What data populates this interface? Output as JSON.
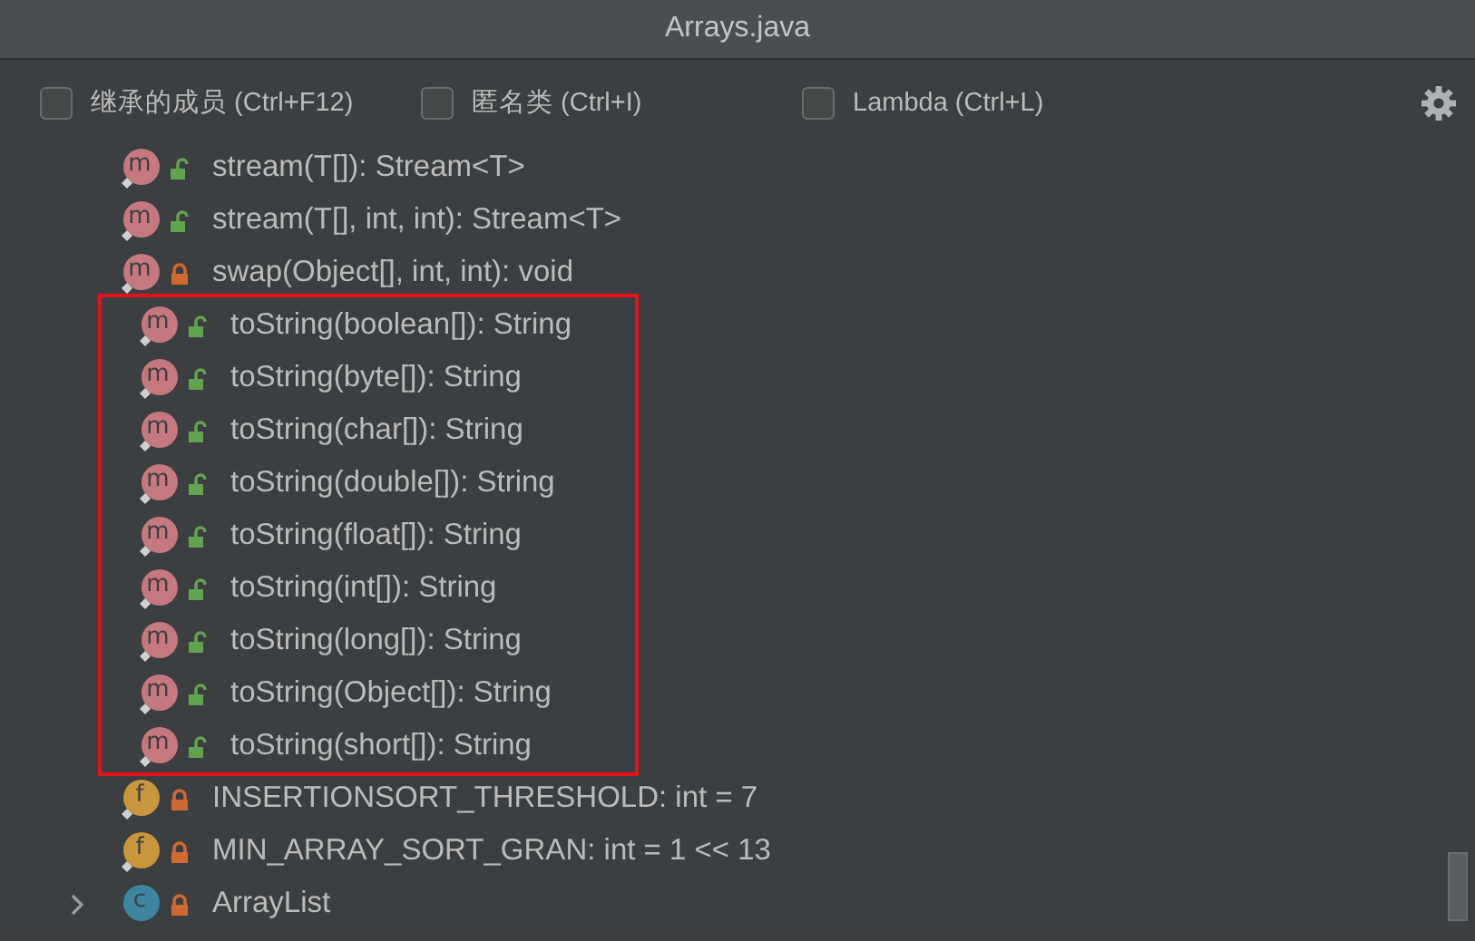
{
  "window": {
    "title": "Arrays.java"
  },
  "filters": [
    {
      "label": "继承的成员 (Ctrl+F12)",
      "checked": false
    },
    {
      "label": "匿名类 (Ctrl+I)",
      "checked": false
    },
    {
      "label": "Lambda (Ctrl+L)",
      "checked": false
    }
  ],
  "members": [
    {
      "kind": "method",
      "icon": "m",
      "locked": false,
      "text": "stream(T[]): Stream<T>",
      "highlighted": false
    },
    {
      "kind": "method",
      "icon": "m",
      "locked": false,
      "text": "stream(T[], int, int): Stream<T>",
      "highlighted": false
    },
    {
      "kind": "method",
      "icon": "m",
      "locked": true,
      "text": "swap(Object[], int, int): void",
      "highlighted": false
    },
    {
      "kind": "method",
      "icon": "m",
      "locked": false,
      "text": "toString(boolean[]): String",
      "highlighted": true
    },
    {
      "kind": "method",
      "icon": "m",
      "locked": false,
      "text": "toString(byte[]): String",
      "highlighted": true
    },
    {
      "kind": "method",
      "icon": "m",
      "locked": false,
      "text": "toString(char[]): String",
      "highlighted": true
    },
    {
      "kind": "method",
      "icon": "m",
      "locked": false,
      "text": "toString(double[]): String",
      "highlighted": true
    },
    {
      "kind": "method",
      "icon": "m",
      "locked": false,
      "text": "toString(float[]): String",
      "highlighted": true
    },
    {
      "kind": "method",
      "icon": "m",
      "locked": false,
      "text": "toString(int[]): String",
      "highlighted": true
    },
    {
      "kind": "method",
      "icon": "m",
      "locked": false,
      "text": "toString(long[]): String",
      "highlighted": true
    },
    {
      "kind": "method",
      "icon": "m",
      "locked": false,
      "text": "toString(Object[]): String",
      "highlighted": true
    },
    {
      "kind": "method",
      "icon": "m",
      "locked": false,
      "text": "toString(short[]): String",
      "highlighted": true
    },
    {
      "kind": "field",
      "icon": "f",
      "locked": true,
      "text": "INSERTIONSORT_THRESHOLD: int = 7",
      "highlighted": false
    },
    {
      "kind": "field",
      "icon": "f",
      "locked": true,
      "text": "MIN_ARRAY_SORT_GRAN: int = 1 << 13",
      "highlighted": false
    },
    {
      "kind": "class",
      "icon": "c",
      "locked": true,
      "text": "ArrayList",
      "highlighted": false,
      "expanded": false
    }
  ]
}
